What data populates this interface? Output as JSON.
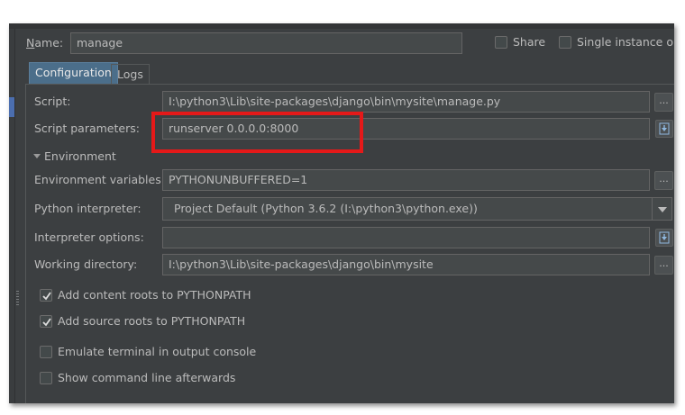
{
  "header": {
    "name_label": "Name:",
    "name_value": "manage",
    "share_label": "Share",
    "single_instance_label": "Single instance onl"
  },
  "tabs": [
    {
      "label": "Configuration",
      "active": true
    },
    {
      "label": "Logs",
      "active": false
    }
  ],
  "form": {
    "script_label": "Script:",
    "script_value": "I:\\python3\\Lib\\site-packages\\django\\bin\\mysite\\manage.py",
    "script_params_label": "Script parameters:",
    "script_params_value": "runserver 0.0.0.0:8000",
    "environment_section": "Environment",
    "env_vars_label": "Environment variables:",
    "env_vars_value": "PYTHONUNBUFFERED=1",
    "interpreter_label": "Python interpreter:",
    "interpreter_value": "Project Default (Python 3.6.2 (I:\\python3\\python.exe))",
    "interp_options_label": "Interpreter options:",
    "interp_options_value": "",
    "working_dir_label": "Working directory:",
    "working_dir_value": "I:\\python3\\Lib\\site-packages\\django\\bin\\mysite",
    "browse_label": "..."
  },
  "checkboxes": [
    {
      "label": "Add content roots to PYTHONPATH",
      "checked": true
    },
    {
      "label": "Add source roots to PYTHONPATH",
      "checked": true
    },
    {
      "label": "Emulate terminal in output console",
      "checked": false
    },
    {
      "label": "Show command line afterwards",
      "checked": false
    }
  ],
  "colors": {
    "background": "#3c3f41",
    "field": "#45494a",
    "active_tab": "#4b6e8a",
    "highlight": "#e51919"
  },
  "icons": {
    "browse": "ellipsis-icon",
    "expand": "expand-field-icon",
    "dropdown": "chevron-down-icon",
    "check": "checkmark-icon"
  }
}
